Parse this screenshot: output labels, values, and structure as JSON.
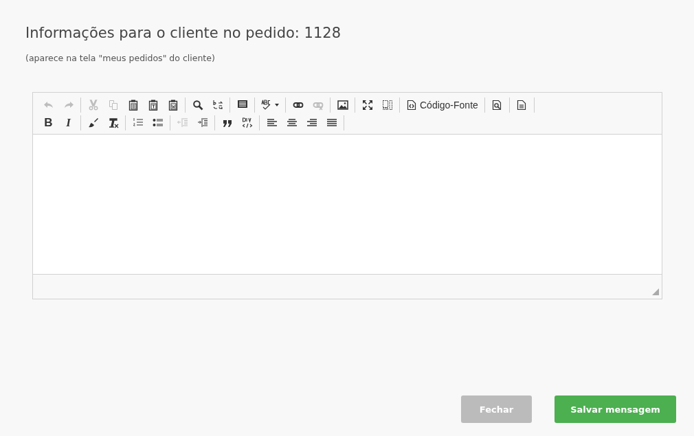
{
  "heading": {
    "title": "Informações para o cliente no pedido: 1128",
    "subtitle": "(aparece na tela \"meus pedidos\" do cliente)"
  },
  "editor": {
    "toolbar_rows": [
      [
        [
          {
            "kind": "undo",
            "disabled": true
          },
          {
            "kind": "redo",
            "disabled": true
          }
        ],
        [
          {
            "kind": "cut",
            "disabled": true
          },
          {
            "kind": "copy",
            "disabled": true
          },
          {
            "kind": "paste",
            "disabled": false
          },
          {
            "kind": "paste-text",
            "disabled": false
          },
          {
            "kind": "paste-word",
            "disabled": false
          }
        ],
        [
          {
            "kind": "find",
            "disabled": false
          },
          {
            "kind": "replace",
            "disabled": false
          }
        ],
        [
          {
            "kind": "select-all",
            "disabled": false
          }
        ],
        [
          {
            "kind": "spellcheck",
            "disabled": false
          }
        ],
        [
          {
            "kind": "link",
            "disabled": false
          },
          {
            "kind": "unlink",
            "disabled": true
          }
        ],
        [
          {
            "kind": "image",
            "disabled": false
          }
        ],
        [
          {
            "kind": "maximize",
            "disabled": false
          },
          {
            "kind": "show-blocks",
            "disabled": false
          }
        ],
        [
          {
            "kind": "source",
            "disabled": false,
            "label": "Código-Fonte"
          }
        ],
        [
          {
            "kind": "preview",
            "disabled": false
          }
        ],
        [
          {
            "kind": "templates",
            "disabled": false
          }
        ]
      ],
      [
        [
          {
            "kind": "bold",
            "disabled": false,
            "label": "B"
          },
          {
            "kind": "italic",
            "disabled": false,
            "label": "I"
          }
        ],
        [
          {
            "kind": "copy-format",
            "disabled": false
          },
          {
            "kind": "remove-format",
            "disabled": false
          }
        ],
        [
          {
            "kind": "numbered-list",
            "disabled": false
          },
          {
            "kind": "bulleted-list",
            "disabled": false
          }
        ],
        [
          {
            "kind": "outdent",
            "disabled": true
          },
          {
            "kind": "indent",
            "disabled": false
          }
        ],
        [
          {
            "kind": "blockquote",
            "disabled": false
          },
          {
            "kind": "div",
            "disabled": false
          }
        ],
        [
          {
            "kind": "align-left",
            "disabled": false
          },
          {
            "kind": "align-center",
            "disabled": false
          },
          {
            "kind": "align-right",
            "disabled": false
          },
          {
            "kind": "align-justify",
            "disabled": false
          }
        ]
      ]
    ]
  },
  "buttons": [
    {
      "kind": "secondary",
      "label": "Fechar"
    },
    {
      "kind": "primary",
      "label": "Salvar mensagem"
    }
  ]
}
